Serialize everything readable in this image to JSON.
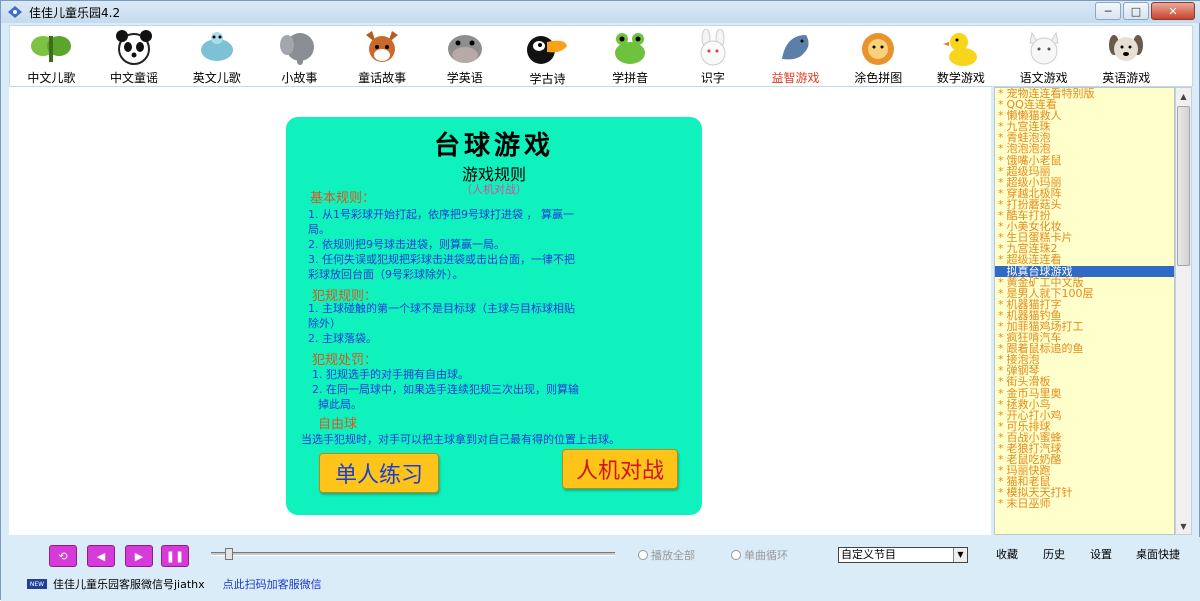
{
  "window": {
    "title": "佳佳儿童乐园4.2",
    "buttons": {
      "minimize": "─",
      "maximize": "□",
      "close": "✕"
    }
  },
  "toolbar": {
    "items": [
      {
        "label": "中文儿歌",
        "icon": "butterfly-icon"
      },
      {
        "label": "中文童谣",
        "icon": "panda-icon"
      },
      {
        "label": "英文儿歌",
        "icon": "turtle-icon"
      },
      {
        "label": "小故事",
        "icon": "elephant-icon"
      },
      {
        "label": "童话故事",
        "icon": "fox-icon"
      },
      {
        "label": "学英语",
        "icon": "hippo-icon"
      },
      {
        "label": "学古诗",
        "icon": "toucan-icon"
      },
      {
        "label": "学拼音",
        "icon": "frog-icon"
      },
      {
        "label": "识字",
        "icon": "rabbit-icon"
      },
      {
        "label": "益智游戏",
        "icon": "dolphin-icon",
        "active": true
      },
      {
        "label": "涂色拼图",
        "icon": "lion-icon"
      },
      {
        "label": "数学游戏",
        "icon": "duck-icon"
      },
      {
        "label": "语文游戏",
        "icon": "cat-icon"
      },
      {
        "label": "英语游戏",
        "icon": "dog-icon"
      }
    ]
  },
  "game": {
    "title": "台球游戏",
    "subtitle": "游戏规则",
    "mode": "（人机对战）",
    "basic_heading": "基本规则：",
    "basic_lines": [
      "1. 从1号彩球开始打起，依序把9号球打进袋 ，  算赢一",
      "局。",
      "2. 依规则把9号球击进袋，则算赢一局。",
      "3. 任何失误或犯规把彩球击进袋或击出台面，一律不把",
      "彩球放回台面（9号彩球除外）。"
    ],
    "foul_heading": "犯规规则：",
    "foul_lines": [
      "1. 主球碰触的第一个球不是目标球（主球与目标球相贴",
      "除外）",
      "2. 主球落袋。"
    ],
    "penalty_heading": "犯规处罚：",
    "penalty_lines": [
      "1. 犯规选手的对手拥有自由球。",
      "2. 在同一局球中，如果选手连续犯规三次出现，则算输",
      "掉此局。"
    ],
    "free_heading": "自由球",
    "free_text": "当选手犯规时，对手可以把主球拿到对自己最有得的位置上击球。",
    "btn_single": "单人练习",
    "btn_vs": "人机对战"
  },
  "game_list": {
    "items": [
      "宠物连连看特别版",
      "QQ连连看",
      "懒懒猫救人",
      "九宫连珠",
      "青蛙泡泡",
      "泡泡泡泡",
      "饿嘴小老鼠",
      "超级玛丽",
      "超级小玛丽",
      "穿越北极阵",
      "打扮蘑菇头",
      "酷车打扮",
      "小美女化妆",
      "生日蛋糕卡片",
      "九宫连珠2",
      "超级连连看",
      "拟真台球游戏",
      "黄金矿工中文版",
      "是男人就下100层",
      "机器猫打字",
      "机器猫钓鱼",
      "加菲猫鸡场打工",
      "疯狂啃汽车",
      "跟着鼠标追的鱼",
      "接泡泡",
      "弹钢琴",
      "街头滑板",
      "金币马里奥",
      "拯救小鸟",
      "开心打小鸡",
      "可乐排球",
      "百战小蜜蜂",
      "老狼打汽球",
      "老鼠吃奶酪",
      "玛丽快跑",
      "猫和老鼠",
      "模拟天天打针",
      "末日巫师"
    ],
    "selected_index": 16
  },
  "player": {
    "controls": [
      "restart-icon",
      "prev-icon",
      "next-icon",
      "pause-icon"
    ],
    "radio_all": "播放全部",
    "radio_single": "单曲循环",
    "program_select": "自定义节目",
    "links": {
      "fav": "收藏",
      "history": "历史",
      "settings": "设置",
      "shortcut": "桌面快捷"
    },
    "contact_text": "佳佳儿童乐园客服微信号jiathx",
    "contact_link": "点此扫码加客服微信"
  }
}
